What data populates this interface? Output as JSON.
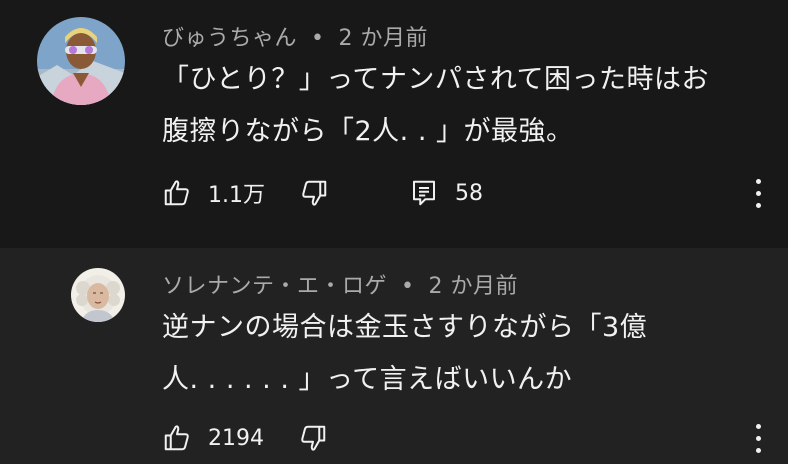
{
  "comments": [
    {
      "author": "びゅうちゃん",
      "separator": "•",
      "time": "2 か月前",
      "text_lines": [
        "「ひとり？」ってナンパされて困った時はお",
        "腹擦りながら「2人. . 」が最強。"
      ],
      "likes": "1.1万",
      "replies": "58",
      "icons": {
        "avatar": "avatar-image",
        "like": "thumbs-up-icon",
        "dislike": "thumbs-down-icon",
        "reply": "comment-icon",
        "more": "more-vert-icon"
      }
    },
    {
      "author": "ソレナンテ・エ・ロゲ",
      "separator": "•",
      "time": "2 か月前",
      "text_lines": [
        "逆ナンの場合は金玉さすりながら「3億",
        "人. . . . . . 」って言えばいいんか"
      ],
      "likes": "2194",
      "icons": {
        "avatar": "avatar-image",
        "like": "thumbs-up-icon",
        "dislike": "thumbs-down-icon",
        "more": "more-vert-icon"
      }
    }
  ],
  "colors": {
    "background": "#181818",
    "reply_background": "#222222",
    "text": "#f1f1f1",
    "meta_text": "#aaaaaa"
  }
}
